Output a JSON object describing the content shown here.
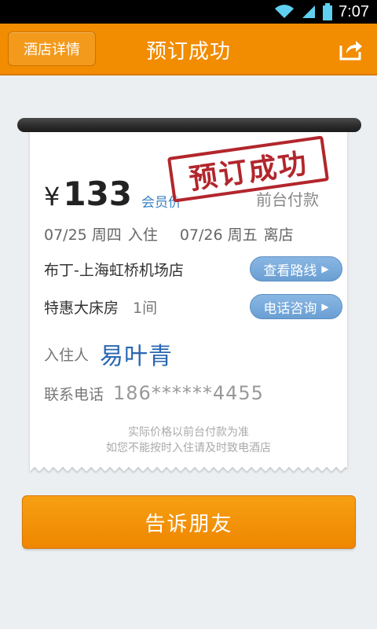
{
  "status_bar": {
    "time": "7:07"
  },
  "header": {
    "back_label": "酒店详情",
    "title": "预订成功"
  },
  "receipt": {
    "stamp_text": "预订成功",
    "currency_symbol": "¥",
    "price": "133",
    "price_tag": "会员价",
    "pay_method": "前台付款",
    "checkin_date": "07/25 周四",
    "checkin_label": "入住",
    "checkout_date": "07/26 周五",
    "checkout_label": "离店",
    "hotel_name": "布丁-上海虹桥机场店",
    "route_button": "查看路线",
    "room_type": "特惠大床房",
    "room_count": "1间",
    "phone_button": "电话咨询",
    "guest_label": "入住人",
    "guest_name": "易叶青",
    "contact_label": "联系电话",
    "contact_phone": "186******4455",
    "note_line1": "实际价格以前台付款为准",
    "note_line2": "如您不能按时入住请及时致电酒店"
  },
  "footer": {
    "share_button": "告诉朋友"
  },
  "colors": {
    "accent": "#f28c00",
    "link_blue": "#3b83c5",
    "stamp_red": "#b2262c"
  }
}
